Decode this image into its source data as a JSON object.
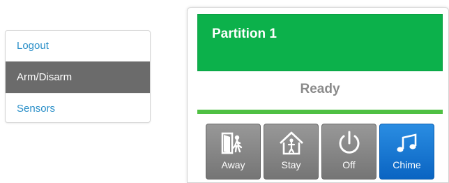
{
  "nav": {
    "items": [
      {
        "label": "Logout",
        "active": false
      },
      {
        "label": "Arm/Disarm",
        "active": true
      },
      {
        "label": "Sensors",
        "active": false
      }
    ]
  },
  "partition": {
    "title": "Partition 1",
    "status": "Ready",
    "colors": {
      "header": "#0cb14b",
      "status_bar": "#4fc043"
    }
  },
  "actions": [
    {
      "label": "Away",
      "icon": "door-person-icon"
    },
    {
      "label": "Stay",
      "icon": "house-person-icon"
    },
    {
      "label": "Off",
      "icon": "power-icon"
    },
    {
      "label": "Chime",
      "icon": "music-note-icon"
    }
  ]
}
